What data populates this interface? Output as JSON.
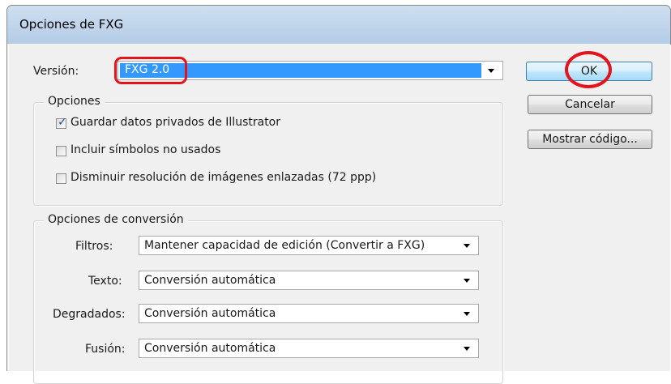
{
  "window": {
    "title": "Opciones de FXG"
  },
  "version": {
    "label": "Versión:",
    "value": "FXG 2.0"
  },
  "options_group": {
    "legend": "Opciones",
    "items": [
      {
        "label": "Guardar datos privados de Illustrator",
        "checked": true
      },
      {
        "label": "Incluir símbolos no usados",
        "checked": false
      },
      {
        "label": "Disminuir resolución de imágenes enlazadas (72 ppp)",
        "checked": false
      }
    ]
  },
  "conversion_group": {
    "legend": "Opciones de conversión",
    "rows": [
      {
        "label": "Filtros:",
        "value": "Mantener capacidad de edición (Convertir a FXG)"
      },
      {
        "label": "Texto:",
        "value": "Conversión automática"
      },
      {
        "label": "Degradados:",
        "value": "Conversión automática"
      },
      {
        "label": "Fusión:",
        "value": "Conversión automática"
      }
    ]
  },
  "buttons": {
    "ok": "OK",
    "cancel": "Cancelar",
    "show_code": "Mostrar código..."
  },
  "annotations": {
    "highlight_color": "#e3141b"
  }
}
